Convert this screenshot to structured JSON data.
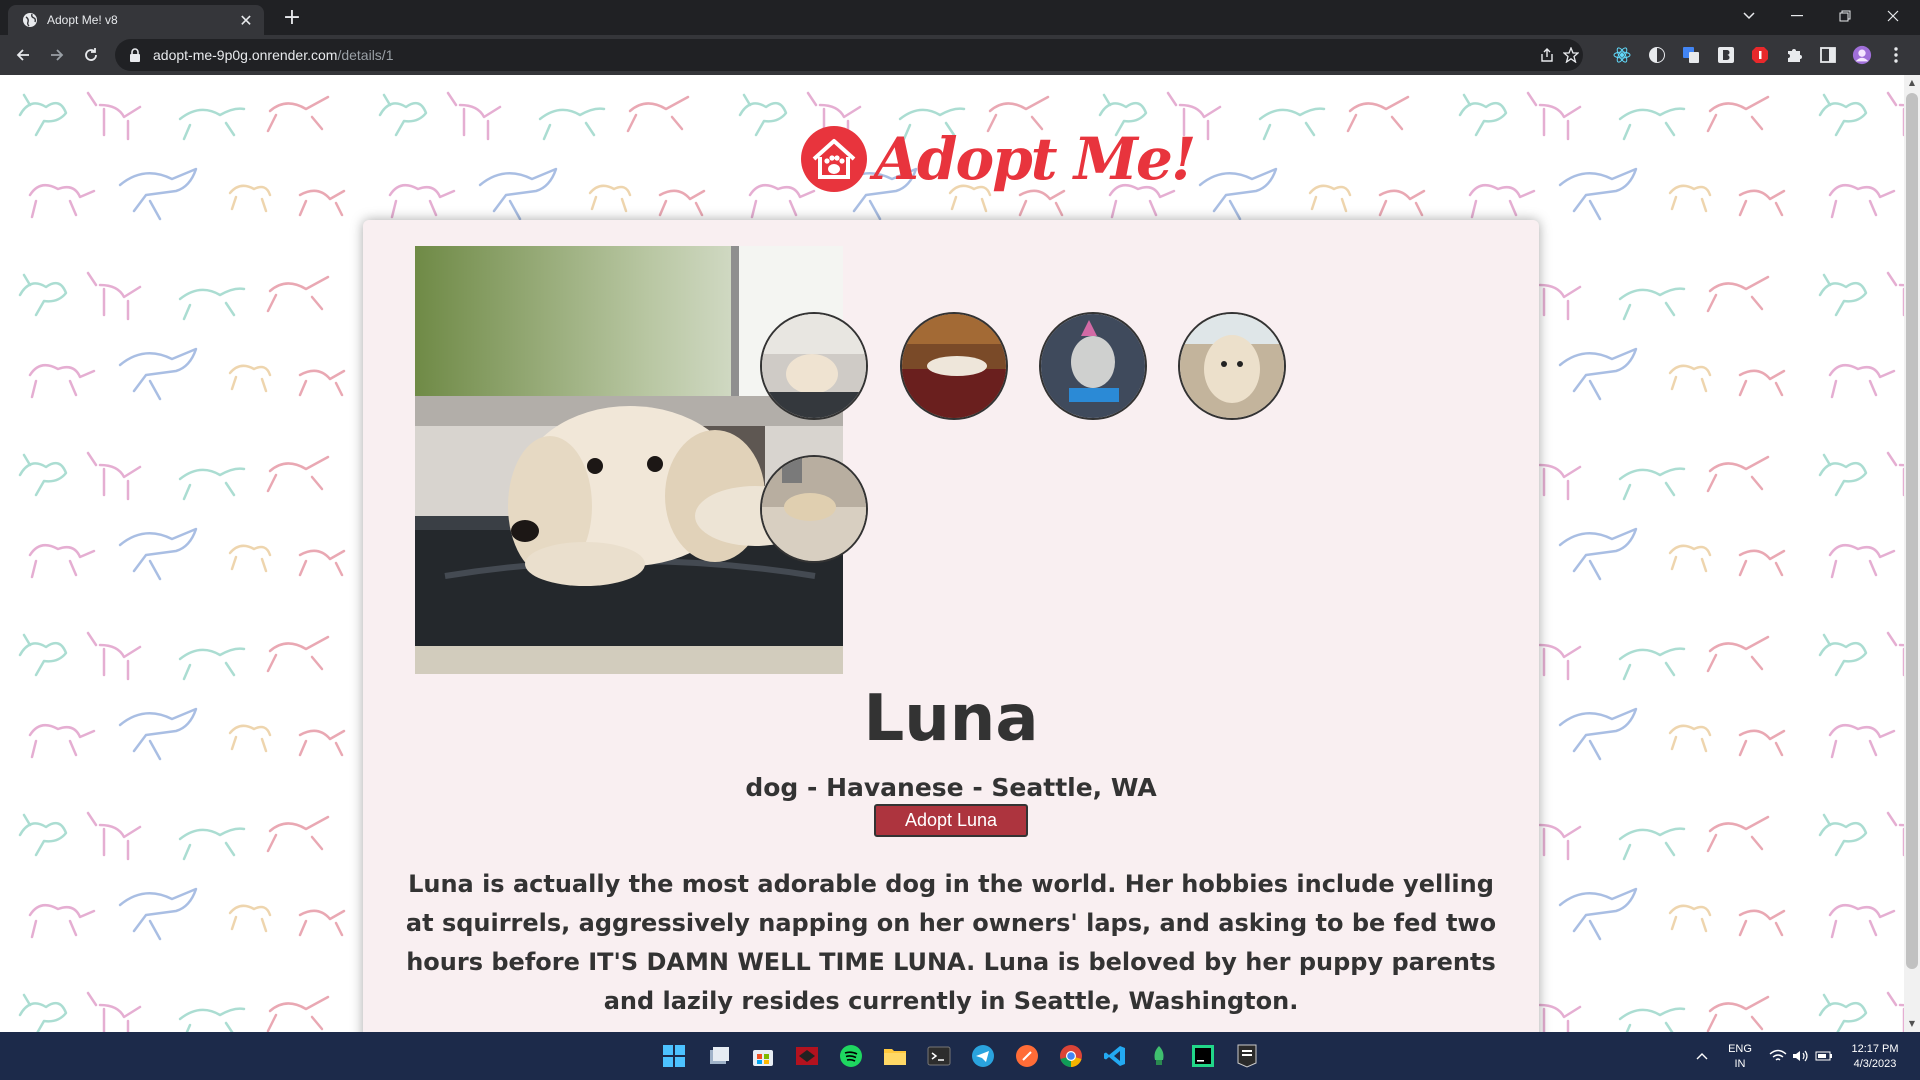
{
  "browser": {
    "tab_title": "Adopt Me! v8",
    "tab_close_glyph": "✕",
    "new_tab_glyph": "+",
    "url_host": "adopt-me-9p0g.onrender.com",
    "url_path": "/details/1"
  },
  "page": {
    "logo_text": "Adopt Me!",
    "pet": {
      "name": "Luna",
      "subtitle": "dog - Havanese - Seattle, WA",
      "adopt_label": "Adopt Luna",
      "description": "Luna is actually the most adorable dog in the world. Her hobbies include yelling at squirrels, aggressively napping on her owners' laps, and asking to be fed two hours before IT'S DAMN WELL TIME LUNA. Luna is beloved by her puppy parents and lazily resides currently in Seattle, Washington."
    }
  },
  "taskbar": {
    "lang_line1": "ENG",
    "lang_line2": "IN",
    "time": "12:17 PM",
    "date": "4/3/2023"
  },
  "colors": {
    "brand_red": "#e8343d",
    "adopt_button": "#ad343e",
    "card_background": "#f9eff1",
    "taskbar": "#1c2a4a"
  }
}
